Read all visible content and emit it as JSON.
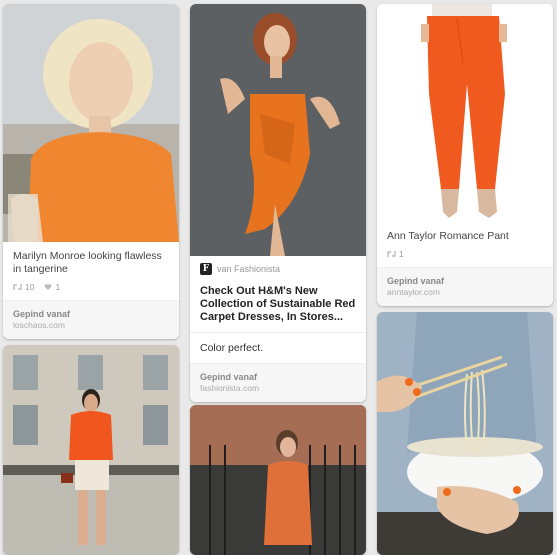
{
  "pins": [
    {
      "description": "Marilyn Monroe looking flawless in tangerine",
      "repins": "10",
      "likes": "1",
      "source_by": "Gepind vanaf",
      "source_site": "loschaos.com"
    },
    {
      "via_label": "van Fashionista",
      "via_logo_letter": "F",
      "title": "Check Out H&M's New Collection of Sustainable Red Carpet Dresses, In Stores...",
      "comment": "Color perfect.",
      "source_by": "Gepind vanaf",
      "source_site": "fashionista.com"
    },
    {
      "description": "Ann Taylor Romance Pant",
      "repins": "1",
      "source_by": "Gepind vanaf",
      "source_site": "anntaylor.com"
    }
  ],
  "colors": {
    "tangerine": "#f07a2a",
    "background": "#e9e9e9"
  }
}
